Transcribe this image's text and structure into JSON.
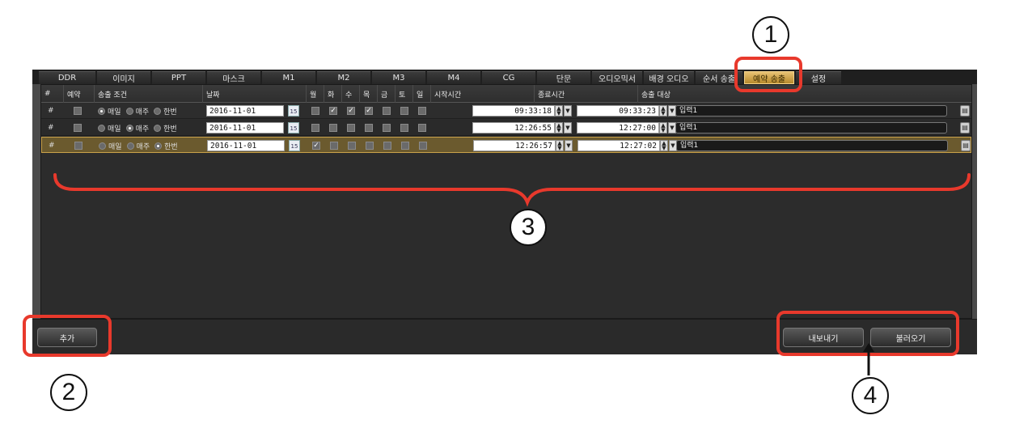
{
  "tabs": [
    {
      "label": "DDR",
      "width": 70
    },
    {
      "label": "이미지",
      "width": 66
    },
    {
      "label": "PPT",
      "width": 66
    },
    {
      "label": "마스크",
      "width": 66
    },
    {
      "label": "M1",
      "width": 66
    },
    {
      "label": "M2",
      "width": 66
    },
    {
      "label": "M3",
      "width": 66
    },
    {
      "label": "M4",
      "width": 66
    },
    {
      "label": "CG",
      "width": 66
    },
    {
      "label": "단문",
      "width": 66
    },
    {
      "label": "오디오믹서",
      "width": 62
    },
    {
      "label": "배경 오디오",
      "width": 62
    },
    {
      "label": "순서 송출",
      "width": 58
    },
    {
      "label": "예약 송출",
      "width": 62,
      "active": true
    },
    {
      "label": "설정",
      "width": 56
    }
  ],
  "columns": {
    "num": "#",
    "reserve": "예약",
    "condition": "송출 조건",
    "date": "날짜",
    "mon": "월",
    "tue": "화",
    "wed": "수",
    "thu": "목",
    "fri": "금",
    "sat": "토",
    "sun": "일",
    "start": "시작시간",
    "end": "종료시간",
    "target": "송출 대상"
  },
  "radio_labels": [
    "매일",
    "매주",
    "한번"
  ],
  "rows": [
    {
      "num": "#",
      "reserved": false,
      "condition": 0,
      "date": "2016-11-01",
      "days": [
        false,
        true,
        true,
        true,
        false,
        false,
        false
      ],
      "start": "09:33:18",
      "end": "09:33:23",
      "target": "입력1"
    },
    {
      "num": "#",
      "reserved": false,
      "condition": 1,
      "date": "2016-11-01",
      "days": [
        false,
        false,
        false,
        false,
        false,
        false,
        false
      ],
      "start": "12:26:55",
      "end": "12:27:00",
      "target": "입력1"
    },
    {
      "num": "#",
      "reserved": false,
      "condition": 2,
      "date": "2016-11-01",
      "days": [
        true,
        false,
        false,
        false,
        false,
        false,
        false
      ],
      "start": "12:26:57",
      "end": "12:27:02",
      "target": "입력1",
      "selected": true
    }
  ],
  "calendar_day": "15",
  "buttons": {
    "add": "추가",
    "export": "내보내기",
    "import": "불러오기"
  },
  "callouts": [
    "1",
    "2",
    "3",
    "4"
  ],
  "colors": {
    "callout": "#e8392c",
    "active_tab": "#d9a84a",
    "selected_row": "#6b5a2e"
  }
}
